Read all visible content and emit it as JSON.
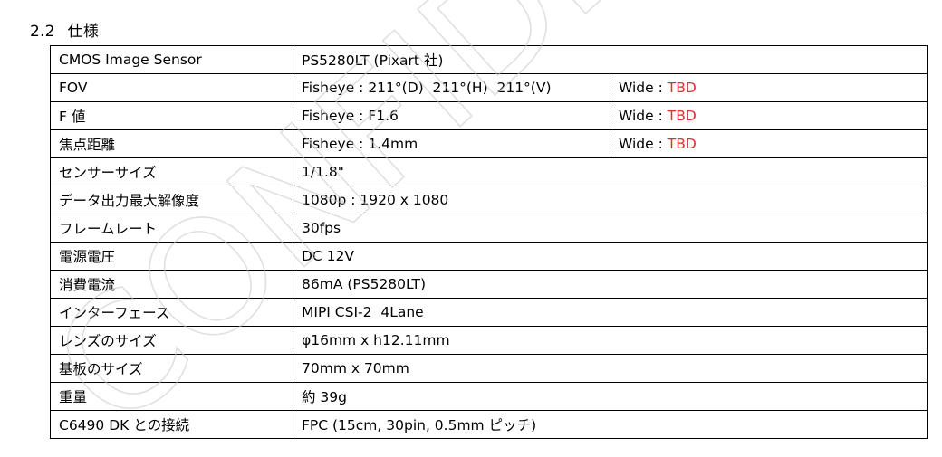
{
  "section": {
    "number": "2.2",
    "title": "仕様"
  },
  "rows": [
    {
      "label": "CMOS Image Sensor",
      "value": "PS5280LT (Pixart 社)"
    },
    {
      "label": "FOV",
      "fisheye": "Fisheye : 211°(D)  211°(H)  211°(V)",
      "wide_prefix": "Wide : ",
      "wide_value": "TBD"
    },
    {
      "label": "F 値",
      "fisheye": "Fisheye : F1.6",
      "wide_prefix": "Wide : ",
      "wide_value": "TBD"
    },
    {
      "label": "焦点距離",
      "fisheye": "Fisheye : 1.4mm",
      "wide_prefix": "Wide : ",
      "wide_value": "TBD"
    },
    {
      "label": "センサーサイズ",
      "value": "1/1.8\""
    },
    {
      "label": "データ出力最大解像度",
      "value": "1080p : 1920 x 1080"
    },
    {
      "label": "フレームレート",
      "value": "30fps"
    },
    {
      "label": "電源電圧",
      "value": "DC 12V"
    },
    {
      "label": "消費電流",
      "value": "86mA (PS5280LT)"
    },
    {
      "label": "インターフェース",
      "value": "MIPI CSI-2  4Lane"
    },
    {
      "label": "レンズのサイズ",
      "value": "φ16mm x h12.11mm"
    },
    {
      "label": "基板のサイズ",
      "value": "70mm x 70mm"
    },
    {
      "label": "重量",
      "value": "約 39g"
    },
    {
      "label": "C6490 DK との接続",
      "value": "FPC (15cm, 30pin, 0.5mm ピッチ)"
    }
  ],
  "watermark": {
    "text": "CONFIDENTIAL",
    "color": "#c8c8c8"
  },
  "colors": {
    "tbd": "#e03030"
  }
}
